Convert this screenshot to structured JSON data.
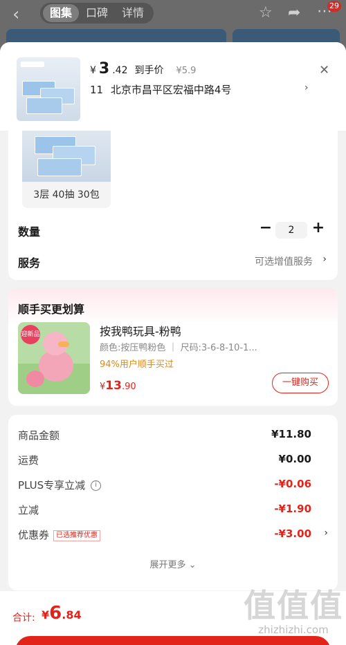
{
  "background": {
    "tabs": [
      "图集",
      "口碑",
      "详情"
    ],
    "active_tab": 0,
    "cart_badge": "29"
  },
  "product": {
    "price_currency": "¥",
    "price_int": "3",
    "price_dec": ".42",
    "price_tag": "到手价",
    "original_price": "¥5.9",
    "address_num": "11",
    "address": "北京市昌平区宏福中路4号"
  },
  "spec": {
    "option_label": "3层 40抽 30包"
  },
  "quantity": {
    "label": "数量",
    "value": "2"
  },
  "service": {
    "label": "服务",
    "value": "可选增值服务"
  },
  "recommend": {
    "title": "顺手买更划算",
    "badge": "迎新品",
    "name": "按我鸭玩具-粉鸭",
    "spec": "颜色:按压鸭粉色 ｜ 尺码:3-6-8-10-1...",
    "bought": "94%用户顺手买过",
    "price_currency": "¥",
    "price_int": "13",
    "price_dec": ".90",
    "buy_label": "一键购买"
  },
  "summary": {
    "rows": [
      {
        "label": "商品金额",
        "value": "¥11.80"
      },
      {
        "label": "运费",
        "value": "¥0.00"
      },
      {
        "label": "PLUS专享立减",
        "value": "-¥0.06"
      },
      {
        "label": "立减",
        "value": "-¥1.90"
      },
      {
        "label": "优惠券",
        "value": "-¥3.00",
        "tag": "已选推荐优惠"
      }
    ],
    "expand_label": "展开更多 ⌄"
  },
  "footer": {
    "total_label": "合计:",
    "total_currency": "¥",
    "total_int": "6",
    "total_dec": ".84"
  },
  "watermark": {
    "big": "值值值",
    "small": "zhizhizhi.com"
  }
}
